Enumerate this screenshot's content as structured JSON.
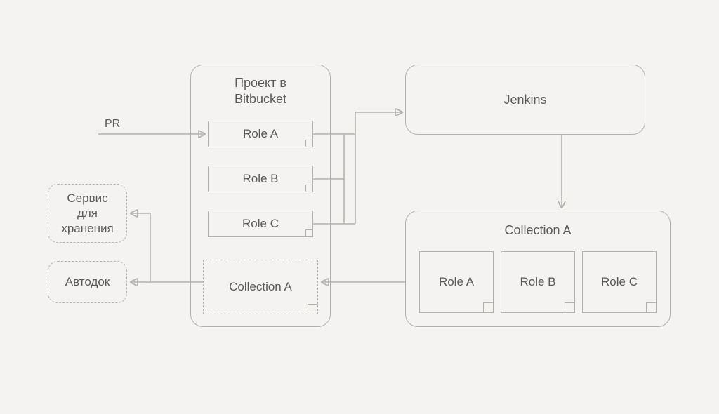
{
  "pr_label": "PR",
  "bitbucket": {
    "title_line1": "Проект в",
    "title_line2": "Bitbucket",
    "roles": [
      "Role A",
      "Role B",
      "Role C"
    ],
    "collection": "Collection A"
  },
  "jenkins": {
    "label": "Jenkins"
  },
  "collection_box": {
    "title": "Collection A",
    "roles": [
      "Role A",
      "Role B",
      "Role C"
    ]
  },
  "storage": {
    "line1": "Сервис",
    "line2": "для",
    "line3": "хранения"
  },
  "autodoc": {
    "label": "Автодок"
  }
}
